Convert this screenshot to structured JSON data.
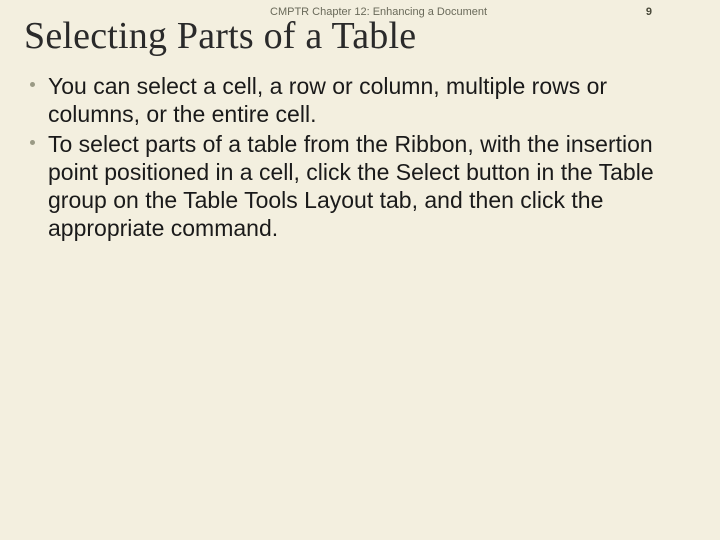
{
  "header": {
    "chapter": "CMPTR Chapter 12: Enhancing a Document",
    "page": "9"
  },
  "title": "Selecting Parts of a Table",
  "bullets": [
    "You can select a cell, a row or column, multiple rows or columns, or the entire cell.",
    "To select parts of a table from the Ribbon, with the insertion point positioned in a cell, click the Select button in the Table group on the Table Tools Layout tab, and then click the appropriate command."
  ]
}
